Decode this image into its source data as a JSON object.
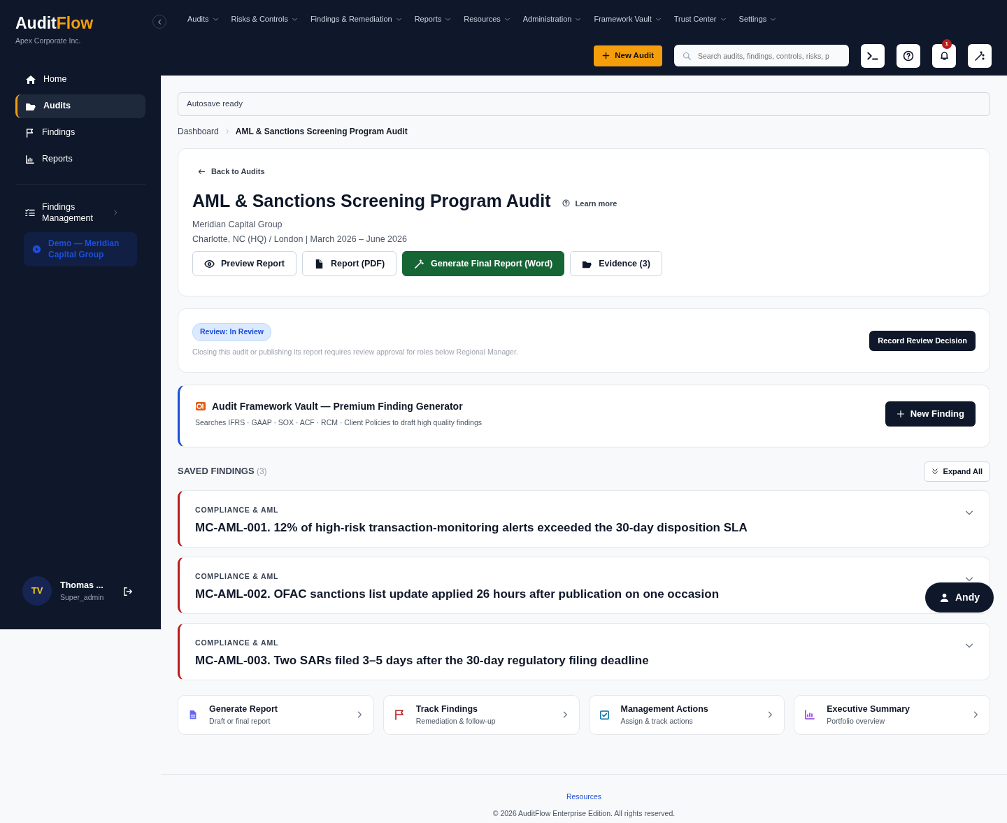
{
  "sidebar": {
    "brand": {
      "first": "Audit",
      "second": "Flow"
    },
    "company": "Apex Corporate Inc.",
    "items": [
      {
        "label": "Home",
        "selected": false
      },
      {
        "label": "Audits",
        "selected": true
      },
      {
        "label": "Findings",
        "selected": false
      },
      {
        "label": "Reports",
        "selected": false
      }
    ],
    "group": {
      "label": "Findings Management",
      "expanded": false
    },
    "demo": "Demo — Meridian Capital Group",
    "user": {
      "initials": "TV",
      "name": "Thomas ...",
      "role": "Super_admin"
    }
  },
  "top_nav": [
    "Audits",
    "Risks & Controls",
    "Findings & Remediation",
    "Reports",
    "Resources",
    "Administration",
    "Framework Vault",
    "Trust Center",
    "Settings"
  ],
  "toolbar": {
    "new_audit": "New Audit",
    "search": {
      "placeholder": "Search audits, findings, controls, risks, p"
    },
    "notifications": "1"
  },
  "autosave": "Autosave ready",
  "breadcrumb": [
    "Dashboard",
    "AML & Sanctions Screening Program Audit"
  ],
  "audit": {
    "back": "Back to Audits",
    "title": "AML & Sanctions Screening Program Audit",
    "learn_more": "Learn more",
    "client": "Meridian Capital Group",
    "details": "Charlotte, NC (HQ) / London | March 2026 – June 2026",
    "actions": [
      {
        "label": "Preview Report",
        "kind": "outline"
      },
      {
        "label": "Report (PDF)",
        "kind": "outline"
      },
      {
        "label": "Generate Final Report (Word)",
        "kind": "primary"
      },
      {
        "label": "Evidence (3)",
        "kind": "outline"
      }
    ]
  },
  "review": {
    "badge": "Review: In Review",
    "note": "Closing this audit or publishing its report requires review approval for roles below Regional Manager.",
    "button": "Record Review Decision"
  },
  "vault": {
    "title": "Audit Framework Vault — Premium Finding Generator",
    "subtitle": "Searches IFRS · GAAP · SOX · ACF · RCM · Client Policies to draft high quality findings",
    "button": "New Finding"
  },
  "saved": {
    "heading": "SAVED FINDINGS",
    "count": "(3)",
    "expand": "Expand All",
    "findings": [
      {
        "category": "COMPLIANCE & AML",
        "title": "MC-AML-001. 12% of high-risk transaction-monitoring alerts exceeded the 30-day disposition SLA",
        "expanded": false
      },
      {
        "category": "COMPLIANCE & AML",
        "title": "MC-AML-002. OFAC sanctions list update applied 26 hours after publication on one occasion",
        "expanded": false
      },
      {
        "category": "COMPLIANCE & AML",
        "title": "MC-AML-003. Two SARs filed 3–5 days after the 30-day regulatory filing deadline",
        "expanded": false
      }
    ]
  },
  "quick_links": [
    {
      "title": "Generate Report",
      "subtitle": "Draft or final report"
    },
    {
      "title": "Track Findings",
      "subtitle": "Remediation & follow-up"
    },
    {
      "title": "Management Actions",
      "subtitle": "Assign & track actions"
    },
    {
      "title": "Executive Summary",
      "subtitle": "Portfolio overview"
    }
  ],
  "chat": "Andy",
  "footer": {
    "link": "Resources",
    "copyright": "© 2026 AuditFlow Enterprise Edition. All rights reserved."
  }
}
